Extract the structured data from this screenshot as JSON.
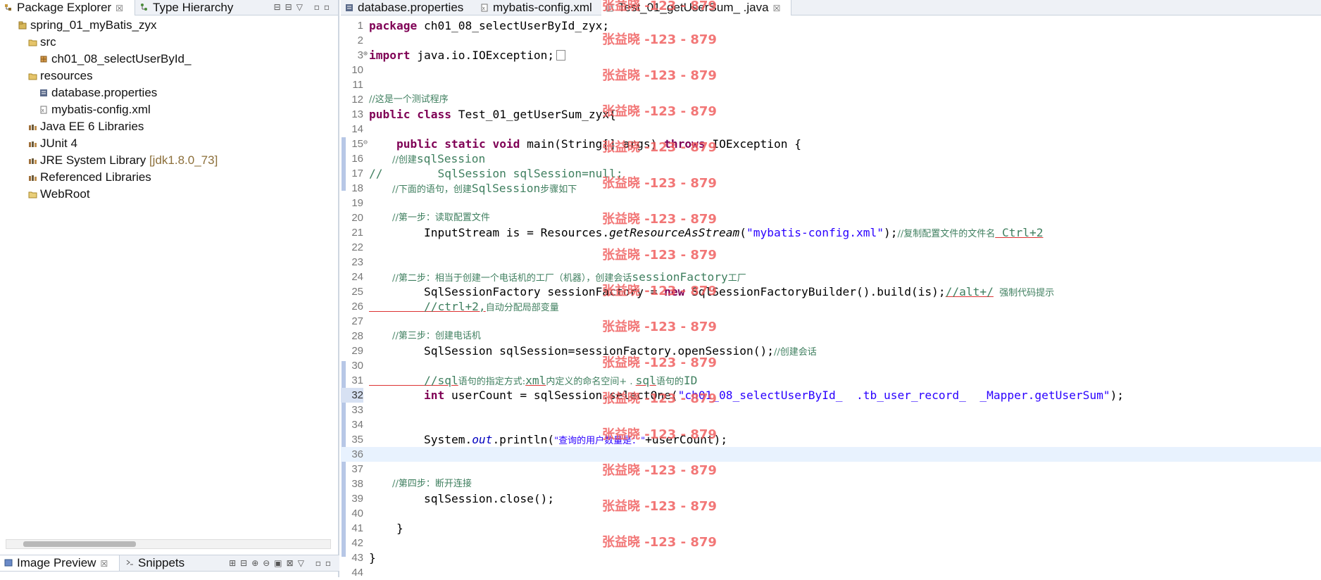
{
  "left_panel": {
    "tabs": [
      {
        "label": "Package Explorer",
        "icon": "package-explorer-icon",
        "close": "☒"
      },
      {
        "label": "Type Hierarchy",
        "icon": "type-hierarchy-icon"
      }
    ],
    "tree": [
      {
        "label": "spring_01_myBatis_zyx",
        "icon": "project-icon"
      },
      {
        "label": "src",
        "icon": "source-folder-icon"
      },
      {
        "label": "ch01_08_selectUserById_",
        "icon": "package-icon"
      },
      {
        "label": "resources",
        "icon": "source-folder-icon"
      },
      {
        "label": "database.properties",
        "icon": "properties-file-icon"
      },
      {
        "label": "mybatis-config.xml",
        "icon": "xml-file-icon"
      },
      {
        "label": "Java EE 6 Libraries",
        "icon": "library-icon"
      },
      {
        "label": "JUnit 4",
        "icon": "library-icon"
      },
      {
        "label": "JRE System Library",
        "version": "[jdk1.8.0_73]",
        "icon": "library-icon"
      },
      {
        "label": "Referenced Libraries",
        "icon": "library-icon"
      },
      {
        "label": "WebRoot",
        "icon": "folder-icon"
      }
    ],
    "bottom_tabs": [
      {
        "label": "Image Preview",
        "icon": "image-preview-icon",
        "close": "☒"
      },
      {
        "label": "Snippets",
        "icon": "snippets-icon"
      }
    ]
  },
  "editor": {
    "tabs": [
      {
        "label": "database.properties",
        "icon": "properties-file-icon"
      },
      {
        "label": "mybatis-config.xml",
        "icon": "xml-file-icon"
      },
      {
        "label": "Test_01_getUserSum_  .java",
        "icon": "java-file-icon",
        "close": "☒"
      }
    ],
    "line_numbers": [
      "1",
      "2",
      "3",
      "10",
      "11",
      "12",
      "13",
      "14",
      "15",
      "16",
      "17",
      "18",
      "19",
      "20",
      "21",
      "22",
      "23",
      "24",
      "25",
      "26",
      "27",
      "28",
      "29",
      "30",
      "31",
      "32",
      "33",
      "34",
      "35",
      "36",
      "37",
      "38",
      "39",
      "40",
      "41",
      "42",
      "43",
      "44"
    ],
    "code": {
      "package_kw": "package",
      "package_name": " ch01_08_selectUserById_zyx;",
      "import_kw": "import",
      "import_name": " java.io.IOException;",
      "comment_test": "//这是一个测试程序",
      "public_kw": "public",
      "class_kw": " class",
      "class_name": " Test_01_getUserSum_zyx{",
      "main_indent": "    ",
      "main_public": "public",
      "main_static": " static",
      "main_void": " void",
      "main_sig": " main(String[] args) ",
      "main_throws": "throws",
      "main_exc": " IOException {",
      "c16_prefix": "        //创建",
      "c16_en": "sqlSession",
      "c17": "//        SqlSession sqlSession=null;",
      "c18_prefix": "        //下面的语句，创建",
      "c18_en": "SqlSession",
      "c18_suffix": "步骤如下",
      "c20": "        //第一步：读取配置文件",
      "l21_code": "        InputStream is = Resources.",
      "l21_method": "getResourceAsStream",
      "l21_open": "(",
      "l21_str": "\"mybatis-config.xml\"",
      "l21_close": ");",
      "l21_cmt": "//复制配置文件的文件名",
      "l21_key": " Ctrl+2",
      "c24_prefix": "        //第二步：相当于创建一个电话机的工厂（机器），创建会话",
      "c24_en": "sessionFactory",
      "c24_suffix": "工厂",
      "l25_code": "        SqlSessionFactory sessionFactory = ",
      "l25_new": "new",
      "l25_rest": " SqlSessionFactoryBuilder().build(is);",
      "l25_cmt_en": "//alt+/",
      "l25_cmt": "  强制代码提示",
      "c26_prefix": "        //ctrl+2,",
      "c26_suffix": "自动分配局部变量",
      "c28": "        //第三步：创建电话机",
      "l29_code": "        SqlSession sqlSession=sessionFactory.openSession();",
      "l29_cmt": "//创建会话",
      "c31_prefix": "        //sql",
      "c31_a": "语句的指定方式:",
      "c31_en": "xml",
      "c31_b": "内定义的命名空间+ . ",
      "c31_sql": "sql",
      "c31_c": "语句的",
      "c31_id": "ID",
      "l32_indent": "        ",
      "l32_int": "int",
      "l32_code": " userCount = sqlSession.selectOne(",
      "l32_str": "\"ch01_08_selectUserById_  .tb_user_record_  _Mapper.getUserSum\"",
      "l32_close": ");",
      "l35_code": "        System.",
      "l35_out": "out",
      "l35_mid": ".println(",
      "l35_str": "\"查询的用户数量是：\"",
      "l35_end": "+userCount);",
      "c38": "        //第四步：断开连接",
      "l39_code": "        sqlSession.close();",
      "l41_code": "    }",
      "l43_code": "}"
    },
    "watermark": "张益晓 -123 - 879"
  },
  "colors": {
    "keyword": "#7f0055",
    "comment": "#3f7f5f",
    "string": "#2a00ff",
    "field": "#0000c0",
    "watermark": "#f06060",
    "current_line": "#e8f2fe"
  }
}
